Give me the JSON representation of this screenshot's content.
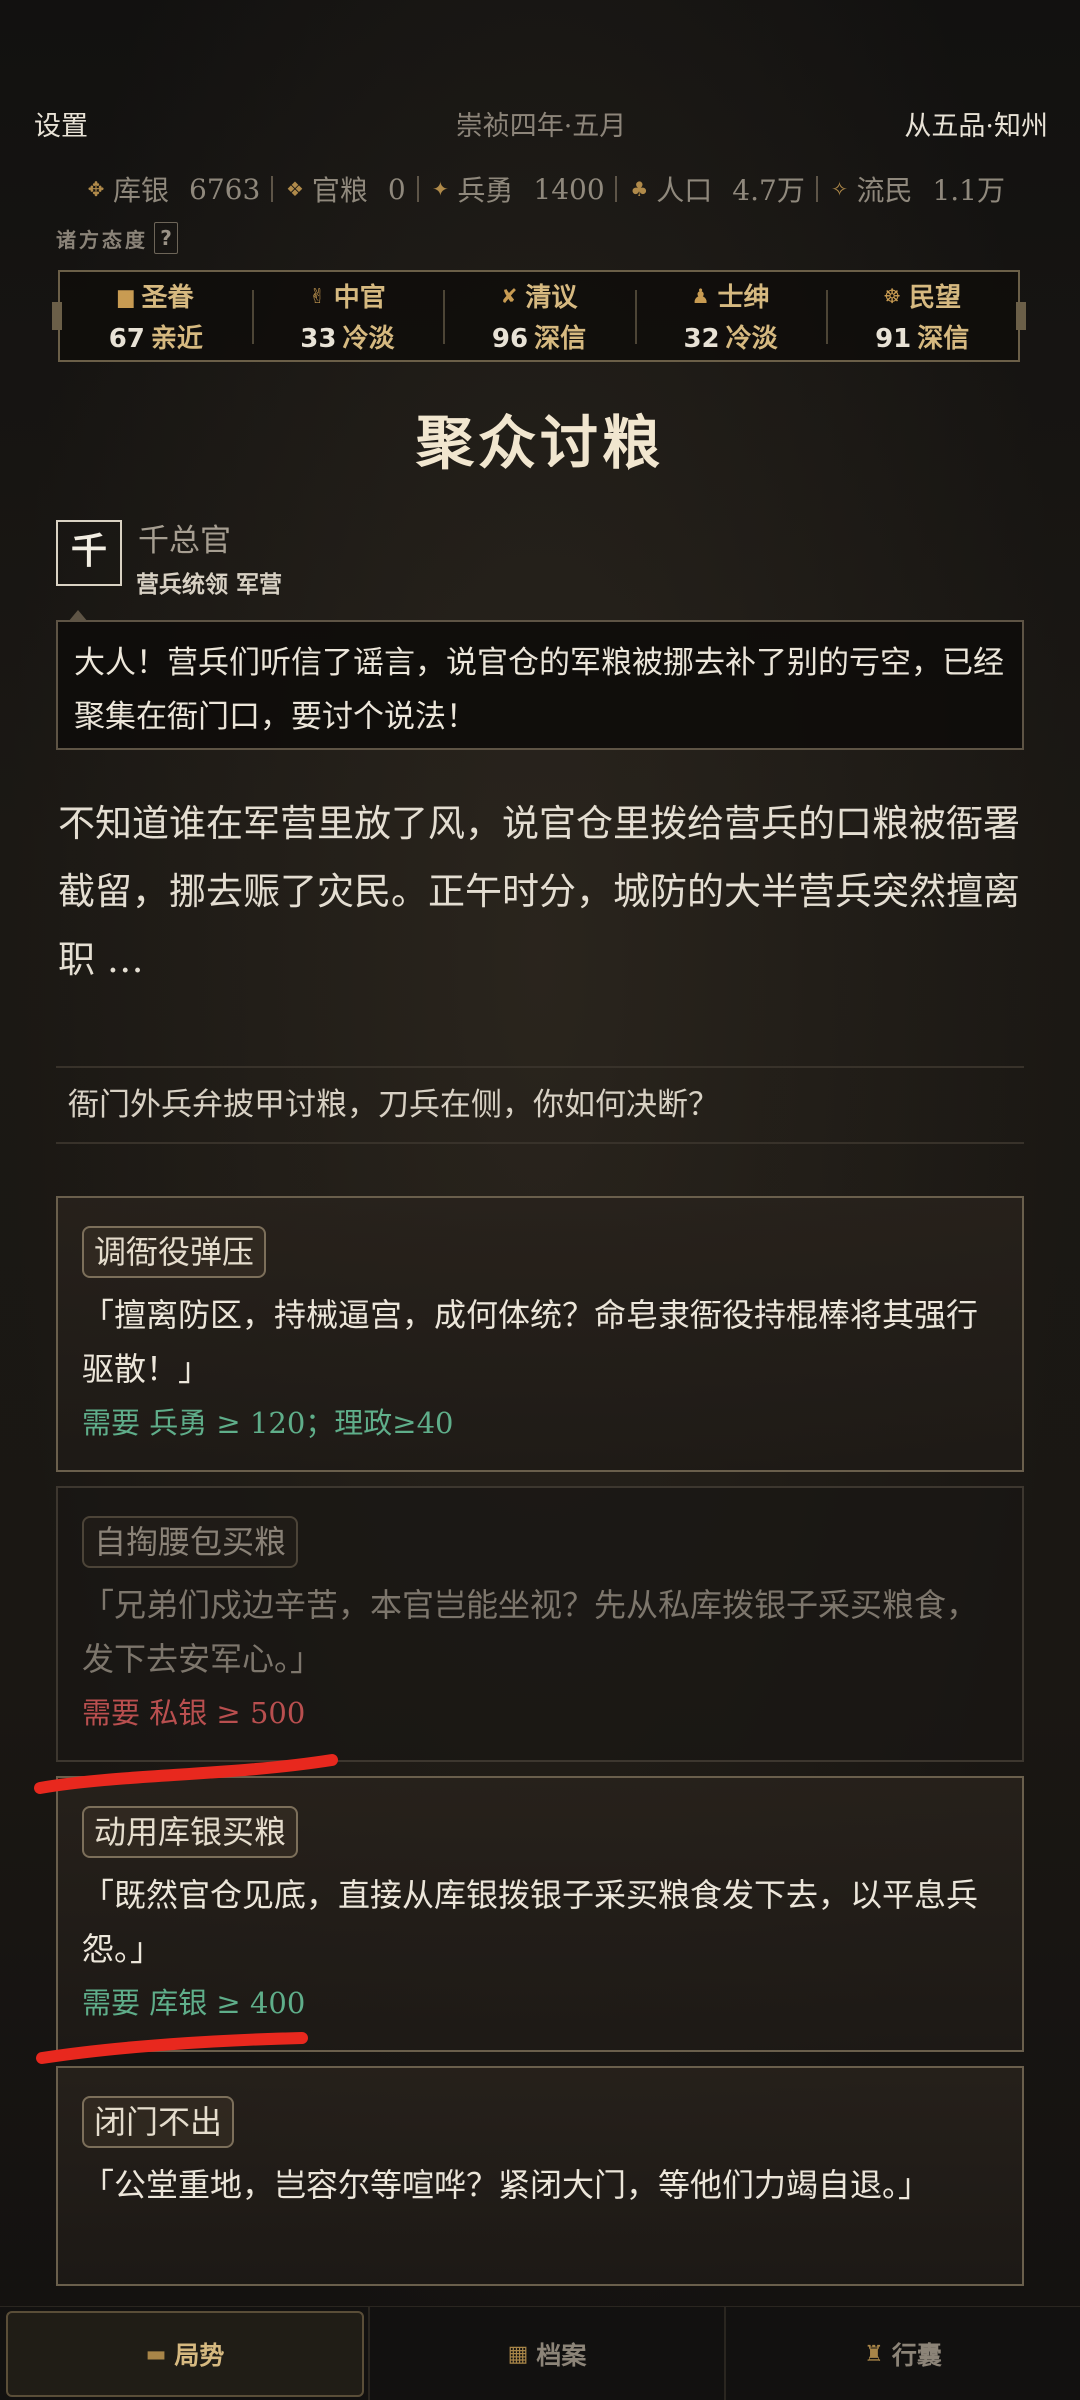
{
  "header": {
    "settings": "设置",
    "date": "崇祯四年·五月",
    "rank": "从五品·知州"
  },
  "resources": [
    {
      "icon": "silver-icon",
      "glyph": "✥",
      "label": "库银",
      "value": "6763"
    },
    {
      "icon": "grain-icon",
      "glyph": "❖",
      "label": "官粮",
      "value": "0"
    },
    {
      "icon": "soldier-icon",
      "glyph": "✦",
      "label": "兵勇",
      "value": "1400"
    },
    {
      "icon": "population-icon",
      "glyph": "♣",
      "label": "人口",
      "value": "4.7万"
    },
    {
      "icon": "refugee-icon",
      "glyph": "✧",
      "label": "流民",
      "value": "1.1万"
    }
  ],
  "attitude": {
    "title": "诸方态度",
    "help": "?"
  },
  "factions": [
    {
      "icon": "edict-icon",
      "glyph": "▆",
      "name": "圣眷",
      "value": "67",
      "status": "亲近"
    },
    {
      "icon": "eunuch-icon",
      "glyph": "✌",
      "name": "中官",
      "value": "33",
      "status": "冷淡"
    },
    {
      "icon": "scholar-icon",
      "glyph": "✘",
      "name": "清议",
      "value": "96",
      "status": "深信"
    },
    {
      "icon": "gentry-icon",
      "glyph": "♟",
      "name": "士绅",
      "value": "32",
      "status": "冷淡"
    },
    {
      "icon": "people-icon",
      "glyph": "☸",
      "name": "民望",
      "value": "91",
      "status": "深信"
    }
  ],
  "event": {
    "title": "聚众讨粮",
    "speaker_seal": "千",
    "speaker_name": "千总官",
    "speaker_role": "营兵统领 军营",
    "quote": "大人！营兵们听信了谣言，说官仓的军粮被挪去补了别的亏空，已经聚集在衙门口，要讨个说法！",
    "narration": "不知道谁在军营里放了风，说官仓里拨给营兵的口粮被衙署截留，挪去赈了灾民。正午时分，城防的大半营兵突然擅离职 …",
    "question": "衙门外兵弁披甲讨粮，刀兵在侧，你如何决断？"
  },
  "choices": [
    {
      "label": "调衙役弹压",
      "text": "「擅离防区，持械逼宫，成何体统？命皂隶衙役持棍棒将其强行驱散！」",
      "requirement": "需要 兵勇 ≥ 120；理政≥40",
      "available": true
    },
    {
      "label": "自掏腰包买粮",
      "text": "「兄弟们戍边辛苦，本官岂能坐视？先从私库拨银子采买粮食，发下去安军心。」",
      "requirement": "需要 私银 ≥ 500",
      "available": false
    },
    {
      "label": "动用库银买粮",
      "text": "「既然官仓见底，直接从库银拨银子采买粮食发下去，以平息兵怨。」",
      "requirement": "需要 库银 ≥ 400",
      "available": true
    },
    {
      "label": "闭门不出",
      "text": "「公堂重地，岂容尔等喧哗？紧闭大门，等他们力竭自退。」",
      "requirement": "",
      "available": true
    }
  ],
  "nav": [
    {
      "icon": "situation-icon",
      "glyph": "▬",
      "label": "局势",
      "active": true
    },
    {
      "icon": "archive-icon",
      "glyph": "▦",
      "label": "档案",
      "active": false
    },
    {
      "icon": "bag-icon",
      "glyph": "♜",
      "label": "行囊",
      "active": false
    }
  ],
  "colors": {
    "gold": "#d6b980",
    "requirement_ok": "#5fae8a",
    "requirement_fail": "#b94f4f",
    "annotation": "#e8281e"
  }
}
